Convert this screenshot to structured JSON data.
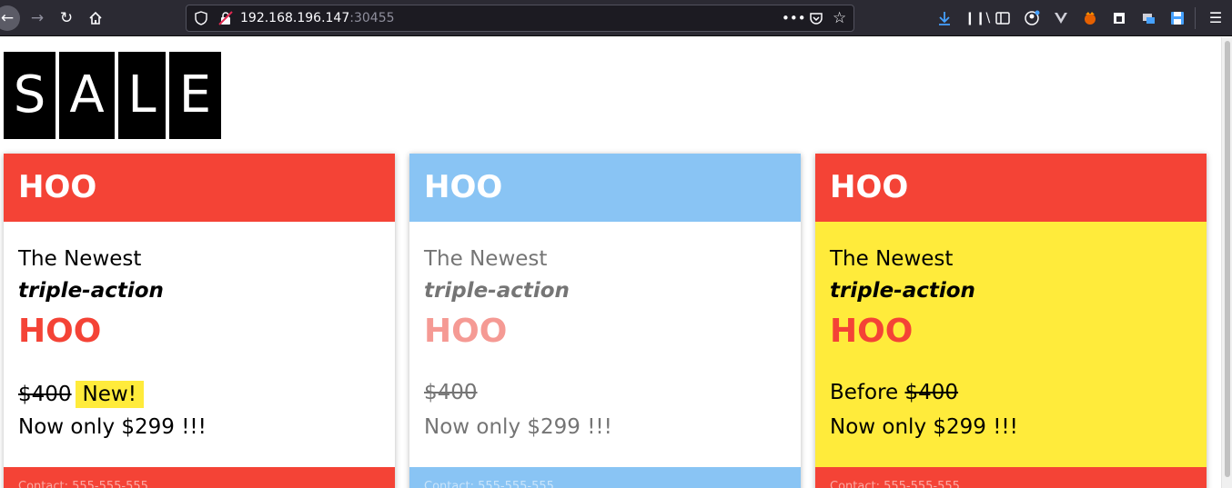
{
  "browser": {
    "url_host": "192.168.196.147",
    "url_port": ":30455"
  },
  "sale_letters": [
    "S",
    "A",
    "L",
    "E"
  ],
  "colors": {
    "red": "#f44336",
    "blue": "#89c4f4",
    "yellow": "#ffeb3b"
  },
  "cards": [
    {
      "header": "HOO",
      "line1": "The Newest",
      "line2": "triple-action",
      "line3": "HOO",
      "old_price": "$400",
      "badge": "New!",
      "now_price": "Now only $299 !!!",
      "footer": "Contact: 555-555-555"
    },
    {
      "header": "HOO",
      "line1": "The Newest",
      "line2": "triple-action",
      "line3": "HOO",
      "old_price": "$400",
      "now_price": "Now only $299 !!!",
      "footer": "Contact: 555-555-555"
    },
    {
      "header": "HOO",
      "line1": "The Newest",
      "line2": "triple-action",
      "line3": "HOO",
      "before_label": "Before ",
      "old_price": "$400",
      "now_price": "Now only $299 !!!",
      "footer": "Contact: 555-555-555"
    }
  ]
}
